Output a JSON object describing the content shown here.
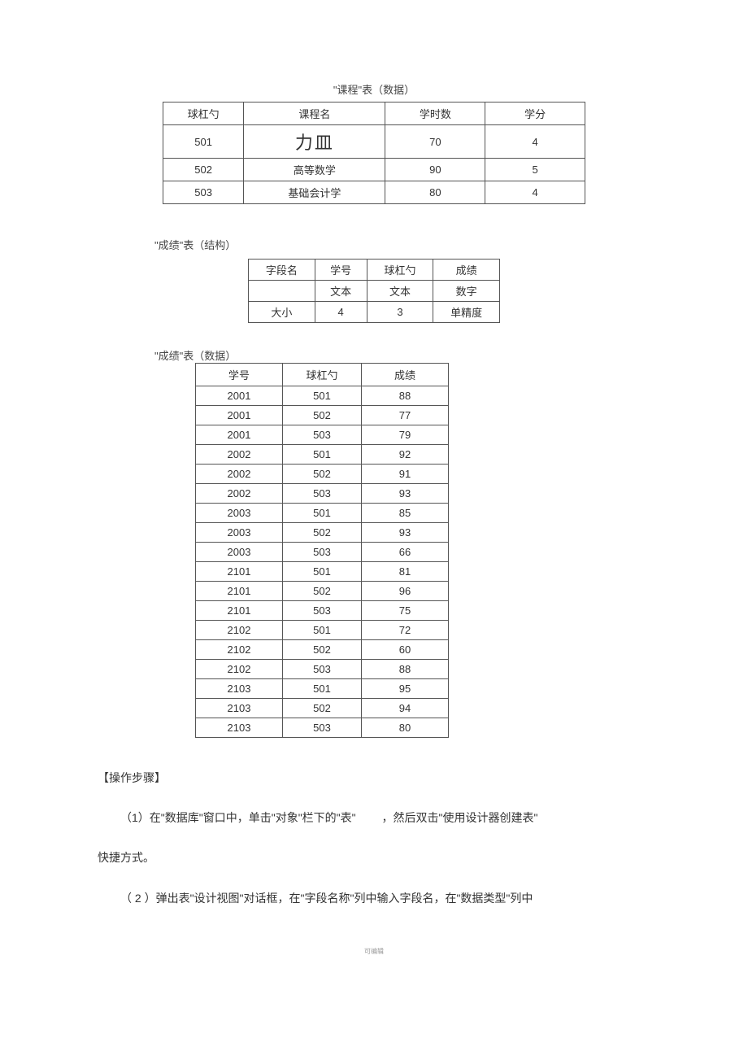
{
  "captions": {
    "table1_title": "\"课程\"表（数据）",
    "table2_title": "\"成绩\"表（结构）",
    "table3_title": "\"成绩\"表（数据）"
  },
  "table1": {
    "headers": [
      "球杠勺",
      "课程名",
      "学时数",
      "学分"
    ],
    "rows": [
      [
        "501",
        "力皿",
        "70",
        "4"
      ],
      [
        "502",
        "高等数学",
        "90",
        "5"
      ],
      [
        "503",
        "基础会计学",
        "80",
        "4"
      ]
    ]
  },
  "table2": {
    "rows": [
      [
        "字段名",
        "学号",
        "球杠勺",
        "成绩"
      ],
      [
        "",
        "文本",
        "文本",
        "数字"
      ],
      [
        "大小",
        "4",
        "3",
        "单精度"
      ]
    ]
  },
  "table3": {
    "headers": [
      "学号",
      "球杠勺",
      "成绩"
    ],
    "rows": [
      [
        "2001",
        "501",
        "88"
      ],
      [
        "2001",
        "502",
        "77"
      ],
      [
        "2001",
        "503",
        "79"
      ],
      [
        "2002",
        "501",
        "92"
      ],
      [
        "2002",
        "502",
        "91"
      ],
      [
        "2002",
        "503",
        "93"
      ],
      [
        "2003",
        "501",
        "85"
      ],
      [
        "2003",
        "502",
        "93"
      ],
      [
        "2003",
        "503",
        "66"
      ],
      [
        "2101",
        "501",
        "81"
      ],
      [
        "2101",
        "502",
        "96"
      ],
      [
        "2101",
        "503",
        "75"
      ],
      [
        "2102",
        "501",
        "72"
      ],
      [
        "2102",
        "502",
        "60"
      ],
      [
        "2102",
        "503",
        "88"
      ],
      [
        "2103",
        "501",
        "95"
      ],
      [
        "2103",
        "502",
        "94"
      ],
      [
        "2103",
        "503",
        "80"
      ]
    ]
  },
  "body": {
    "heading": "【操作步骤】",
    "step1_a": "（1）在\"数据库\"窗口中，单击\"对象\"栏下的\"表\"",
    "step1_b": "，然后双击\"使用设计器创建表\"",
    "step1_c": "快捷方式。",
    "step2": "（ 2 ）弹出表\"设计视图\"对话框，在\"字段名称\"列中输入字段名，在\"数据类型\"列中"
  },
  "footer": "可编辑"
}
